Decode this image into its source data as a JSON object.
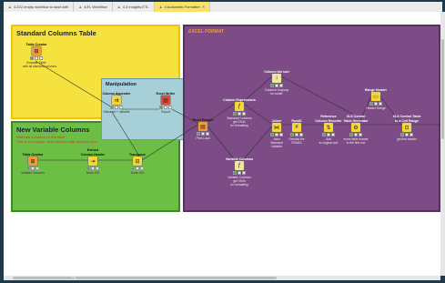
{
  "tabs": [
    {
      "label": "4.222 empty workflow to start with",
      "icon": "workflow-icon",
      "active": false
    },
    {
      "label": "4.EL Workflow",
      "icon": "workflow-icon",
      "active": false
    },
    {
      "label": "4.3 Insights ETL",
      "icon": "workflow-icon",
      "active": false
    },
    {
      "label": "4 Automatic Formatter",
      "icon": "workflow-icon",
      "active": true
    }
  ],
  "annotations": {
    "standard": {
      "title": "Standard Columns Table",
      "color": "#f6e23e"
    },
    "manipulation": {
      "title": "Manipulation",
      "color": "#a6cfd8"
    },
    "new_variable": {
      "title": "New Variable Columns",
      "note1": "Add new columns on the table",
      "note2": "This is to manage new columns with dynamic field",
      "color": "#6dbe45"
    },
    "excel": {
      "title": "EXCEL FORMAT",
      "color": "#7d4c86"
    }
  },
  "nodes": {
    "table_creator_1": {
      "label": "Table Creator",
      "desc": "Example Table\nwith all standard columns"
    },
    "column_appender": {
      "label": "Column Appender",
      "desc": "Standard + Variable"
    },
    "excel_writer": {
      "label": "Excel Writer",
      "desc": "Export"
    },
    "table_creator_2": {
      "label": "Table Creator",
      "desc": "Variable Columns"
    },
    "extract_header": {
      "label": "Extract\nColumn Header",
      "desc": "Node 233"
    },
    "transpose": {
      "label": "Transpose",
      "desc": "Node 234"
    },
    "excel_reader": {
      "label": "Excel Reader",
      "desc": "Files Load"
    },
    "column_expressions": {
      "label": "Column Expressions",
      "desc": "Standard Columns\nget TAGs\nfor formatting"
    },
    "column_list_sort": {
      "label": "Column list sort",
      "desc": "Columns Ungroup\nfor sorter"
    },
    "joiner": {
      "label": "Joiner",
      "desc": "Joins\nStandard\nVariable"
    },
    "rowid": {
      "label": "RowID",
      "desc": "Reinitial the\nROWID"
    },
    "reference_column": {
      "label": "Reference\nColumn Resorter",
      "desc": "Sort\nto original sort"
    },
    "xlse_control": {
      "label": "XLS Control\nTable Generator",
      "desc": "move table header\nto the first row"
    },
    "range_header": {
      "label": "Range Header",
      "desc": "Header Range"
    },
    "xls_control_cell": {
      "label": "XLS Control Table\nto a Cell Range",
      "desc": "get first header"
    },
    "variable_columns": {
      "label": "Variable Columns",
      "desc": "Variable Columns\nget TAGs\nfor formatting"
    }
  }
}
